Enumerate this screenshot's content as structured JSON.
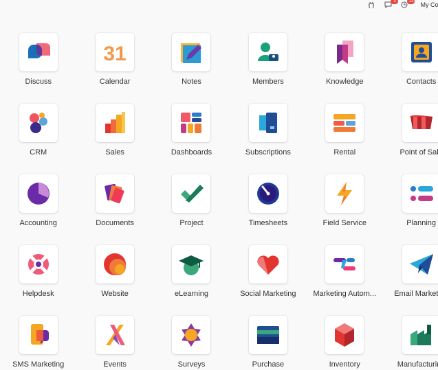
{
  "topbar": {
    "chat_badge": "3",
    "activity_badge": "13",
    "company": "My Compa"
  },
  "apps": [
    {
      "label": "Discuss",
      "icon": "discuss-icon"
    },
    {
      "label": "Calendar",
      "icon": "calendar-icon"
    },
    {
      "label": "Notes",
      "icon": "notes-icon"
    },
    {
      "label": "Members",
      "icon": "members-icon"
    },
    {
      "label": "Knowledge",
      "icon": "knowledge-icon"
    },
    {
      "label": "Contacts",
      "icon": "contacts-icon"
    },
    {
      "label": "CRM",
      "icon": "crm-icon"
    },
    {
      "label": "Sales",
      "icon": "sales-icon"
    },
    {
      "label": "Dashboards",
      "icon": "dashboards-icon"
    },
    {
      "label": "Subscriptions",
      "icon": "subscriptions-icon"
    },
    {
      "label": "Rental",
      "icon": "rental-icon"
    },
    {
      "label": "Point of Sale",
      "icon": "point-of-sale-icon"
    },
    {
      "label": "Accounting",
      "icon": "accounting-icon"
    },
    {
      "label": "Documents",
      "icon": "documents-icon"
    },
    {
      "label": "Project",
      "icon": "project-icon"
    },
    {
      "label": "Timesheets",
      "icon": "timesheets-icon"
    },
    {
      "label": "Field Service",
      "icon": "field-service-icon"
    },
    {
      "label": "Planning",
      "icon": "planning-icon"
    },
    {
      "label": "Helpdesk",
      "icon": "helpdesk-icon"
    },
    {
      "label": "Website",
      "icon": "website-icon"
    },
    {
      "label": "eLearning",
      "icon": "elearning-icon"
    },
    {
      "label": "Social Marketing",
      "icon": "social-marketing-icon"
    },
    {
      "label": "Marketing Autom...",
      "icon": "marketing-automation-icon"
    },
    {
      "label": "Email Marketing",
      "icon": "email-marketing-icon"
    },
    {
      "label": "SMS Marketing",
      "icon": "sms-marketing-icon"
    },
    {
      "label": "Events",
      "icon": "events-icon"
    },
    {
      "label": "Surveys",
      "icon": "surveys-icon"
    },
    {
      "label": "Purchase",
      "icon": "purchase-icon"
    },
    {
      "label": "Inventory",
      "icon": "inventory-icon"
    },
    {
      "label": "Manufacturing",
      "icon": "manufacturing-icon"
    }
  ]
}
